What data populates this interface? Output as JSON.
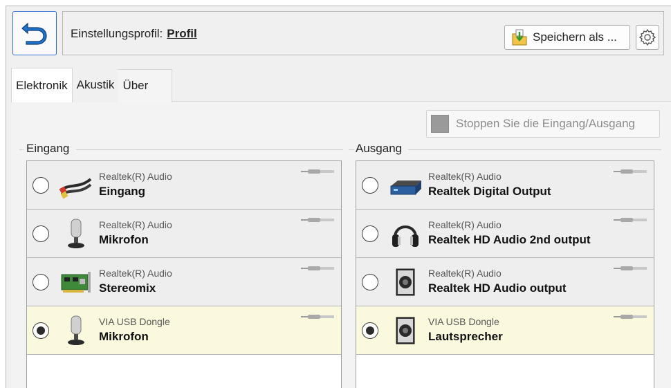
{
  "header": {
    "profile_label": "Einstellungsprofil:",
    "profile_name": "Profil",
    "save_as_label": "Speichern als ..."
  },
  "tabs": [
    {
      "label": "Elektronik",
      "active": true
    },
    {
      "label": "Akustik",
      "active": false
    },
    {
      "label": "Über",
      "active": false
    }
  ],
  "stop_button_label": "Stoppen Sie die Eingang/Ausgang",
  "input_group": {
    "title": "Eingang",
    "devices": [
      {
        "vendor": "Realtek(R) Audio",
        "name": "Eingang",
        "icon": "rca-cable-icon",
        "selected": false
      },
      {
        "vendor": "Realtek(R) Audio",
        "name": "Mikrofon",
        "icon": "microphone-icon",
        "selected": false
      },
      {
        "vendor": "Realtek(R) Audio",
        "name": "Stereomix",
        "icon": "sound-card-icon",
        "selected": false
      },
      {
        "vendor": "VIA USB Dongle",
        "name": "Mikrofon",
        "icon": "microphone-icon",
        "selected": true
      }
    ]
  },
  "output_group": {
    "title": "Ausgang",
    "devices": [
      {
        "vendor": "Realtek(R) Audio",
        "name": "Realtek Digital Output",
        "icon": "digital-receiver-icon",
        "selected": false
      },
      {
        "vendor": "Realtek(R) Audio",
        "name": "Realtek HD Audio 2nd output",
        "icon": "headphones-icon",
        "selected": false
      },
      {
        "vendor": "Realtek(R) Audio",
        "name": "Realtek HD Audio output",
        "icon": "speaker-icon",
        "selected": false
      },
      {
        "vendor": "VIA USB Dongle",
        "name": "Lautsprecher",
        "icon": "speaker-icon",
        "selected": true
      }
    ]
  },
  "colors": {
    "accent_border": "#2f6fd0",
    "selected_row": "#fbf9dd",
    "row_bg": "#eeeeee"
  }
}
